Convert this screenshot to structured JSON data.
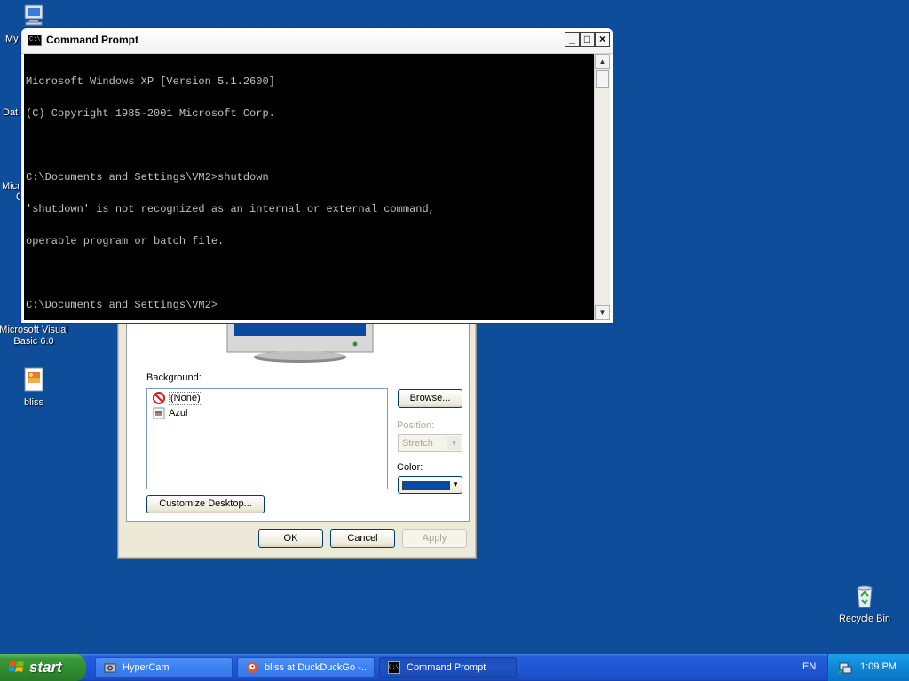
{
  "desktop": {
    "icons": {
      "my_partial": "My",
      "data_partial": "Dat",
      "micro_partial": "Micro",
      "c_partial": "C",
      "vb6": "Microsoft Visual Basic 6.0",
      "bliss": "bliss",
      "recycle_bin": "Recycle Bin"
    }
  },
  "display_dialog": {
    "background_label": "Background:",
    "background_items": [
      "(None)",
      "Azul"
    ],
    "browse_label": "Browse...",
    "position_label": "Position:",
    "position_value": "Stretch",
    "color_label": "Color:",
    "color_value": "#0b4a9e",
    "customize_label": "Customize Desktop...",
    "ok_label": "OK",
    "cancel_label": "Cancel",
    "apply_label": "Apply"
  },
  "cmd_window": {
    "title": "Command Prompt",
    "minimize": "_",
    "maximize": "□",
    "close": "×",
    "console_lines": [
      "Microsoft Windows XP [Version 5.1.2600]",
      "(C) Copyright 1985-2001 Microsoft Corp.",
      "",
      "C:\\Documents and Settings\\VM2>shutdown",
      "'shutdown' is not recognized as an internal or external command,",
      "operable program or batch file.",
      "",
      "C:\\Documents and Settings\\VM2>"
    ]
  },
  "taskbar": {
    "start_label": "start",
    "tasks": [
      {
        "label": "HyperCam",
        "icon": "hypercam-icon"
      },
      {
        "label": "bliss at DuckDuckGo -...",
        "icon": "duckduckgo-icon"
      },
      {
        "label": "Command Prompt",
        "icon": "cmd-icon"
      }
    ],
    "language": "EN",
    "clock": "1:09 PM"
  },
  "colors": {
    "desktop_bg": "#0e4d9a",
    "console_bg": "#000000",
    "console_fg": "#c0c0c0",
    "taskbar_blue": "#245edb",
    "start_green": "#3b9a3b"
  }
}
